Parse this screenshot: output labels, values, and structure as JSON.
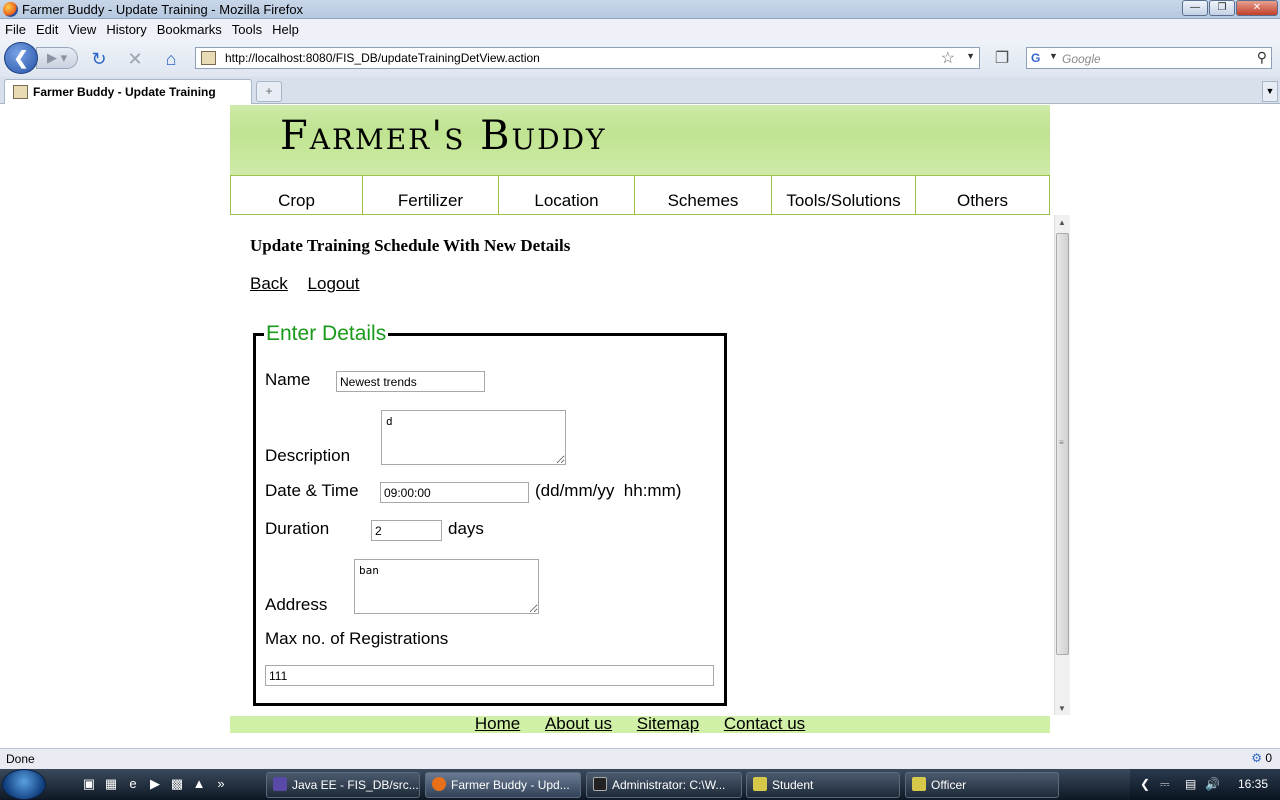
{
  "window": {
    "title": "Farmer Buddy - Update Training - Mozilla Firefox"
  },
  "menu": [
    "File",
    "Edit",
    "View",
    "History",
    "Bookmarks",
    "Tools",
    "Help"
  ],
  "navbar": {
    "url": "http://localhost:8080/FIS_DB/updateTrainingDetView.action",
    "search_placeholder": "Google"
  },
  "tabs": [
    {
      "label": "Farmer Buddy - Update Training"
    }
  ],
  "site": {
    "brand": "Farmer's Buddy",
    "nav": [
      "Crop",
      "Fertilizer",
      "Location",
      "Schemes",
      "Tools/Solutions",
      "Others"
    ],
    "footer": [
      "Home",
      "About us",
      "Sitemap",
      "Contact us"
    ]
  },
  "page": {
    "title": "Update Training Schedule With New Details",
    "back": "Back",
    "logout": "Logout",
    "legend": "Enter Details",
    "form": {
      "name_label": "Name",
      "name_value": "Newest trends",
      "description_label": "Description",
      "description_value": "d",
      "datetime_label": "Date & Time",
      "datetime_value": "09:00:00",
      "datetime_hint": "(dd/mm/yy  hh:mm)",
      "duration_label": "Duration",
      "duration_value": "2",
      "duration_unit": "days",
      "address_label": "Address",
      "address_value": "ban",
      "maxreg_label": "Max no. of Registrations",
      "maxreg_value": "111"
    }
  },
  "status": {
    "text": "Done",
    "right": "0"
  },
  "taskbar": {
    "items": [
      {
        "label": "Java EE - FIS_DB/src..."
      },
      {
        "label": "Farmer Buddy - Upd..."
      },
      {
        "label": "Administrator: C:\\W..."
      },
      {
        "label": "Student"
      },
      {
        "label": "Officer"
      }
    ],
    "clock": "16:35"
  }
}
